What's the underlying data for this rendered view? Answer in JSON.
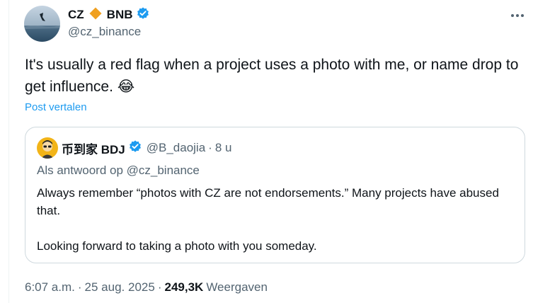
{
  "author": {
    "display_name": "CZ",
    "brand": "BNB",
    "handle": "@cz_binance"
  },
  "tweet": {
    "text": "It's usually a red flag when a project uses a photo with me, or name drop to get influence. 😂",
    "translate_link": "Post vertalen"
  },
  "quote": {
    "display_name": "币到家 BDJ",
    "handle": "@B_daojia",
    "separator": "·",
    "time": "8 u",
    "reply_to": "Als antwoord op @cz_binance",
    "paragraphs": [
      "Always remember “photos with CZ are not endorsements.” Many projects have abused that.",
      "Looking forward to taking a photo with you someday."
    ]
  },
  "meta": {
    "time": "6:07 a.m.",
    "separator1": "·",
    "date": "25 aug. 2025",
    "separator2": "·",
    "views_count": "249,3K",
    "views_label": "Weergaven"
  },
  "colors": {
    "link": "#1d9bf0",
    "verified": "#1d9bf0",
    "secondary_text": "#536471",
    "diamond": "#f0a020"
  },
  "icons": {
    "more": "more-horizontal-icon",
    "verified": "verified-badge-icon",
    "brand": "bnb-diamond-icon"
  }
}
